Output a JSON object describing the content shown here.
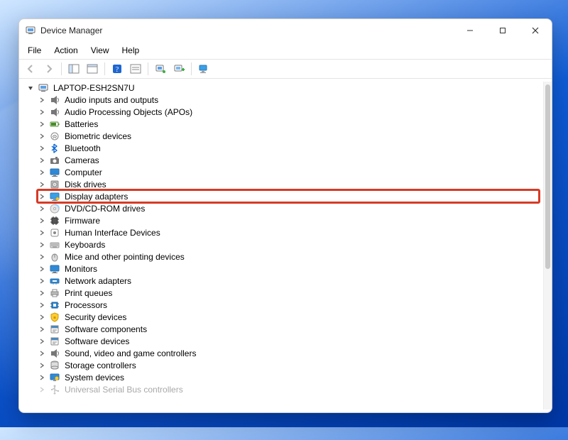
{
  "window": {
    "title": "Device Manager"
  },
  "titlebar_controls": {
    "minimize": "Minimize",
    "maximize": "Maximize",
    "close": "Close"
  },
  "menu": {
    "file": "File",
    "action": "Action",
    "view": "View",
    "help": "Help"
  },
  "toolbar": {
    "back": "Back",
    "forward": "Forward",
    "show_hide_tree": "Show/Hide Console Tree",
    "properties": "Properties",
    "help": "Help",
    "action_center": "Action",
    "scan_hardware": "Scan for hardware changes",
    "add_legacy": "Add legacy hardware",
    "devices_by_type": "Devices by type"
  },
  "tree": {
    "root": "LAPTOP-ESH2SN7U",
    "items": [
      {
        "label": "Audio inputs and outputs",
        "icon": "speaker"
      },
      {
        "label": "Audio Processing Objects (APOs)",
        "icon": "speaker"
      },
      {
        "label": "Batteries",
        "icon": "battery"
      },
      {
        "label": "Biometric devices",
        "icon": "fingerprint"
      },
      {
        "label": "Bluetooth",
        "icon": "bluetooth"
      },
      {
        "label": "Cameras",
        "icon": "camera"
      },
      {
        "label": "Computer",
        "icon": "monitor"
      },
      {
        "label": "Disk drives",
        "icon": "disk"
      },
      {
        "label": "Display adapters",
        "icon": "display",
        "highlighted": true
      },
      {
        "label": "DVD/CD-ROM drives",
        "icon": "disc"
      },
      {
        "label": "Firmware",
        "icon": "chip"
      },
      {
        "label": "Human Interface Devices",
        "icon": "hid"
      },
      {
        "label": "Keyboards",
        "icon": "keyboard"
      },
      {
        "label": "Mice and other pointing devices",
        "icon": "mouse"
      },
      {
        "label": "Monitors",
        "icon": "monitor"
      },
      {
        "label": "Network adapters",
        "icon": "network"
      },
      {
        "label": "Print queues",
        "icon": "printer"
      },
      {
        "label": "Processors",
        "icon": "cpu"
      },
      {
        "label": "Security devices",
        "icon": "security"
      },
      {
        "label": "Software components",
        "icon": "software"
      },
      {
        "label": "Software devices",
        "icon": "software"
      },
      {
        "label": "Sound, video and game controllers",
        "icon": "speaker"
      },
      {
        "label": "Storage controllers",
        "icon": "storage"
      },
      {
        "label": "System devices",
        "icon": "system"
      },
      {
        "label": "Universal Serial Bus controllers",
        "icon": "usb",
        "cutoff": true
      }
    ]
  }
}
